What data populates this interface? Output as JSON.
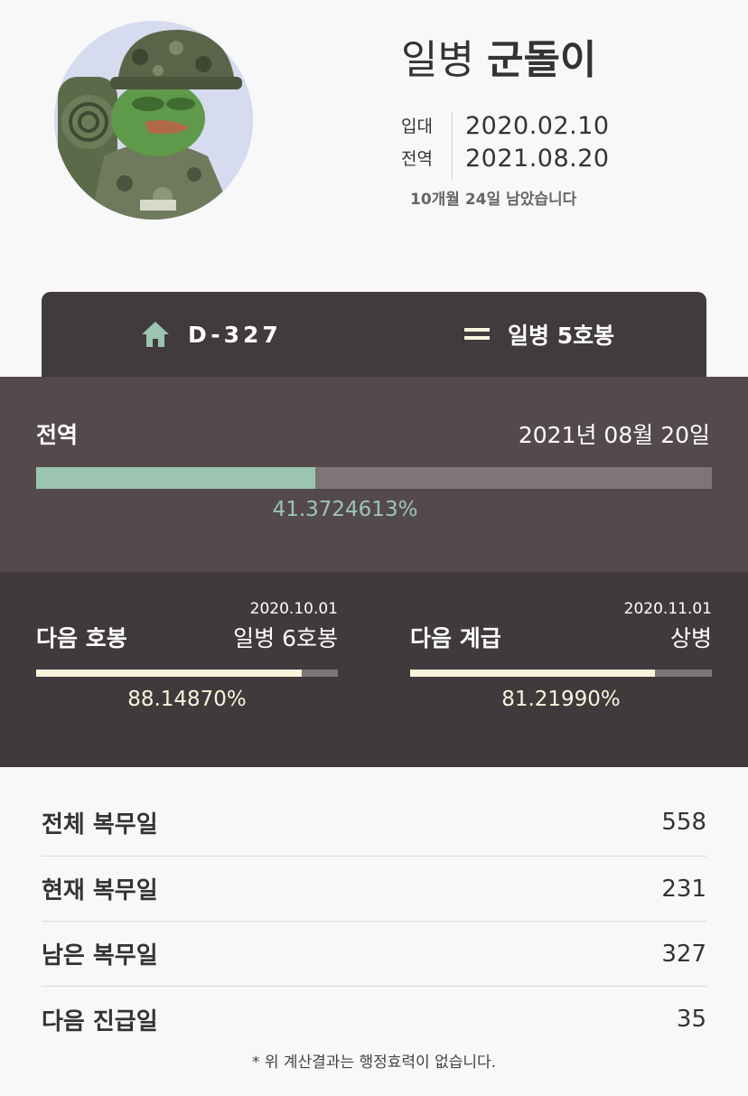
{
  "profile": {
    "rank": "일병",
    "name": "군돌이",
    "enlist_label": "입대",
    "enlist_date": "2020.02.10",
    "discharge_label": "전역",
    "discharge_date": "2021.08.20",
    "remaining_text": "10개월 24일 남았습니다"
  },
  "tabs": [
    {
      "icon": "home-icon",
      "label": "D-327"
    },
    {
      "icon": "rank-stripes-icon",
      "label": "일병 5호봉"
    }
  ],
  "discharge_progress": {
    "title": "전역",
    "date": "2021년 08월 20일",
    "percent_text": "41.3724613%",
    "fraction": 0.413724613
  },
  "next_steps": [
    {
      "title": "다음 호봉",
      "date": "2020.10.01",
      "target": "일병 6호봉",
      "percent_text": "88.14870%",
      "fraction": 0.881487
    },
    {
      "title": "다음 계급",
      "date": "2020.11.01",
      "target": "상병",
      "percent_text": "81.21990%",
      "fraction": 0.812199
    }
  ],
  "stats": [
    {
      "label": "전체 복무일",
      "value": "558"
    },
    {
      "label": "현재 복무일",
      "value": "231"
    },
    {
      "label": "남은 복무일",
      "value": "327"
    },
    {
      "label": "다음 진급일",
      "value": "35"
    }
  ],
  "disclaimer": "* 위 계산결과는 행정효력이 없습니다.",
  "colors": {
    "accent_green": "#9cc5b1",
    "accent_cream": "#faf5dc",
    "tab_bg": "#413b3d",
    "discharge_bg": "#544a4d",
    "next_bg": "#403a3c"
  }
}
